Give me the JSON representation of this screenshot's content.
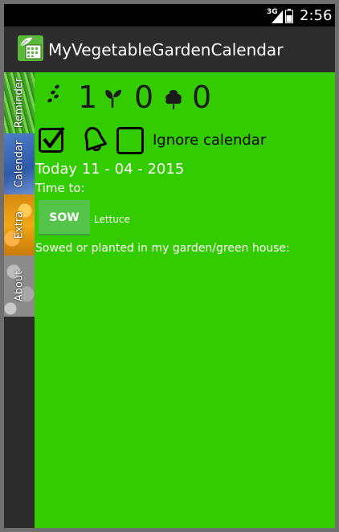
{
  "status_bar": {
    "network": "3G",
    "time": "2:56"
  },
  "app": {
    "title": "MyVegetableGardenCalendar"
  },
  "tabs": [
    {
      "label": "Reminder"
    },
    {
      "label": "Calendar"
    },
    {
      "label": "Extra"
    },
    {
      "label": "About"
    }
  ],
  "counters": {
    "seeds": "1",
    "seedlings": "0",
    "trees": "0"
  },
  "options": {
    "reminder_checked": true,
    "ignore_checked": false,
    "ignore_label": "Ignore calendar"
  },
  "today": "Today 11 - 04 - 2015",
  "time_to_label": "Time to:",
  "tasks": [
    {
      "action": "SOW",
      "crop": "Lettuce"
    }
  ],
  "sowed_label": "Sowed or planted in my garden/green house:",
  "colors": {
    "main_bg": "#33cc00",
    "action_bar": "#2c2c2c",
    "button": "#55c44a"
  }
}
